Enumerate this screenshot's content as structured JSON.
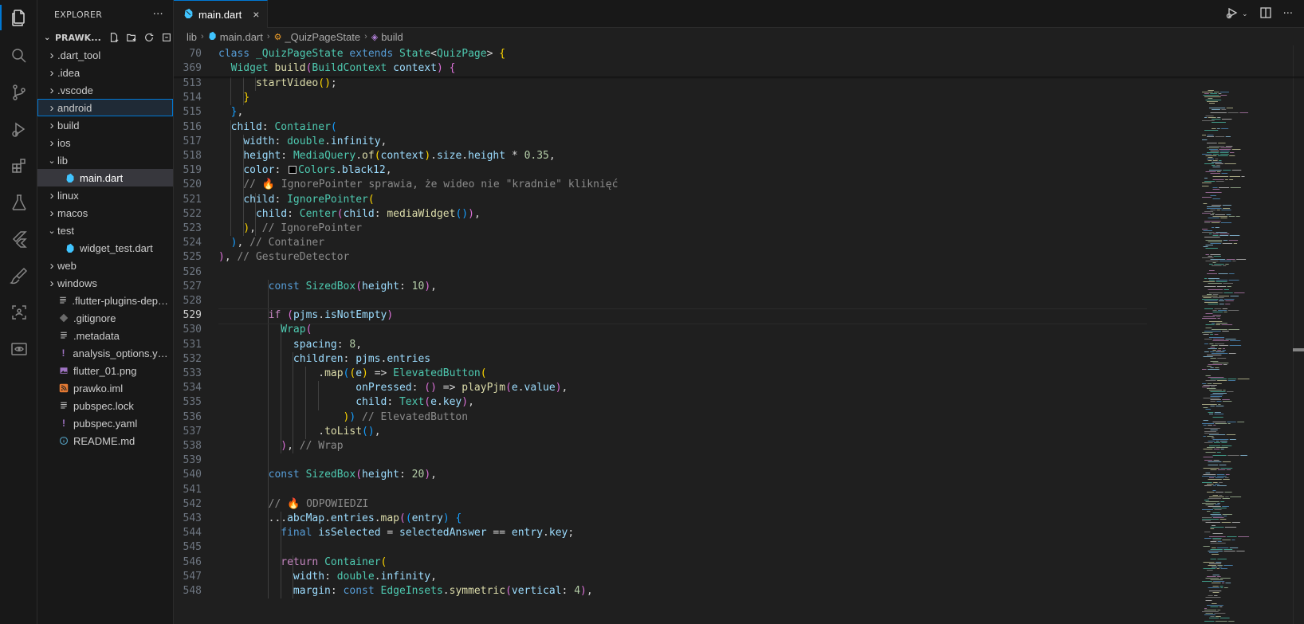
{
  "activity_bar": [
    "files-icon",
    "search-icon",
    "source-control-icon",
    "run-debug-icon",
    "extensions-icon",
    "testing-icon",
    "flutter-icon",
    "paint-icon",
    "remote-explorer-icon",
    "preview-icon"
  ],
  "sidebar": {
    "title": "EXPLORER",
    "more": "···",
    "folder": "PRAWK...",
    "items": [
      {
        "label": ".dart_tool",
        "type": "folder",
        "depth": 0
      },
      {
        "label": ".idea",
        "type": "folder",
        "depth": 0
      },
      {
        "label": ".vscode",
        "type": "folder",
        "depth": 0
      },
      {
        "label": "android",
        "type": "folder",
        "depth": 0,
        "focused": true
      },
      {
        "label": "build",
        "type": "folder",
        "depth": 0
      },
      {
        "label": "ios",
        "type": "folder",
        "depth": 0
      },
      {
        "label": "lib",
        "type": "folder-open",
        "depth": 0
      },
      {
        "label": "main.dart",
        "type": "dart",
        "depth": 1,
        "selected": true
      },
      {
        "label": "linux",
        "type": "folder",
        "depth": 0
      },
      {
        "label": "macos",
        "type": "folder",
        "depth": 0
      },
      {
        "label": "test",
        "type": "folder-open",
        "depth": 0
      },
      {
        "label": "widget_test.dart",
        "type": "dart",
        "depth": 1
      },
      {
        "label": "web",
        "type": "folder",
        "depth": 0
      },
      {
        "label": "windows",
        "type": "folder",
        "depth": 0
      },
      {
        "label": ".flutter-plugins-depen...",
        "type": "file",
        "depth": 0
      },
      {
        "label": ".gitignore",
        "type": "git",
        "depth": 0
      },
      {
        "label": ".metadata",
        "type": "file",
        "depth": 0
      },
      {
        "label": "analysis_options.yaml",
        "type": "yaml",
        "depth": 0
      },
      {
        "label": "flutter_01.png",
        "type": "png",
        "depth": 0
      },
      {
        "label": "prawko.iml",
        "type": "rss",
        "depth": 0
      },
      {
        "label": "pubspec.lock",
        "type": "file",
        "depth": 0
      },
      {
        "label": "pubspec.yaml",
        "type": "yaml",
        "depth": 0
      },
      {
        "label": "README.md",
        "type": "info",
        "depth": 0
      }
    ]
  },
  "tabs": [
    {
      "label": "main.dart",
      "close": "×"
    }
  ],
  "breadcrumb": [
    "lib",
    "main.dart",
    "_QuizPageState",
    "build"
  ],
  "sticky_lines": [
    {
      "num": "70",
      "html": "<span class=\"k\">class</span> <span class=\"t\">_QuizPageState</span> <span class=\"k\">extends</span> <span class=\"t\">State</span><span class=\"p\">&lt;</span><span class=\"t\">QuizPage</span><span class=\"p\">&gt;</span> <span class=\"b1\">{</span>"
    },
    {
      "num": "369",
      "html": "  <span class=\"t\">Widget</span> <span class=\"f\">build</span><span class=\"b2\">(</span><span class=\"t\">BuildContext</span> <span class=\"v\">context</span><span class=\"b2\">)</span> <span class=\"b2\">{</span>"
    }
  ],
  "code_lines": [
    {
      "num": "513",
      "html": "      <span class=\"f\">startVideo</span><span class=\"b1\">()</span><span class=\"p\">;</span>"
    },
    {
      "num": "514",
      "html": "    <span class=\"b1\">}</span>"
    },
    {
      "num": "515",
      "html": "  <span class=\"b3\">}</span><span class=\"p\">,</span>"
    },
    {
      "num": "516",
      "html": "  <span class=\"v\">child</span><span class=\"p\">:</span> <span class=\"t\">Container</span><span class=\"b3\">(</span>"
    },
    {
      "num": "517",
      "html": "    <span class=\"v\">width</span><span class=\"p\">:</span> <span class=\"t\">double</span><span class=\"p\">.</span><span class=\"v\">infinity</span><span class=\"p\">,</span>"
    },
    {
      "num": "518",
      "html": "    <span class=\"v\">height</span><span class=\"p\">:</span> <span class=\"t\">MediaQuery</span><span class=\"p\">.</span><span class=\"f\">of</span><span class=\"b1\">(</span><span class=\"v\">context</span><span class=\"b1\">)</span><span class=\"p\">.</span><span class=\"v\">size</span><span class=\"p\">.</span><span class=\"v\">height</span> <span class=\"p\">*</span> <span class=\"n\">0.35</span><span class=\"p\">,</span>"
    },
    {
      "num": "519",
      "html": "    <span class=\"v\">color</span><span class=\"p\">:</span> <span class=\"swatch\"></span><span class=\"t\">Colors</span><span class=\"p\">.</span><span class=\"v\">black12</span><span class=\"p\">,</span>"
    },
    {
      "num": "520",
      "html": "    <span class=\"c\">// 🔥 IgnorePointer sprawia, że wideo nie \"kradnie\" kliknięć</span>"
    },
    {
      "num": "521",
      "html": "    <span class=\"v\">child</span><span class=\"p\">:</span> <span class=\"t\">IgnorePointer</span><span class=\"b1\">(</span>"
    },
    {
      "num": "522",
      "html": "      <span class=\"v\">child</span><span class=\"p\">:</span> <span class=\"t\">Center</span><span class=\"b2\">(</span><span class=\"v\">child</span><span class=\"p\">:</span> <span class=\"f\">mediaWidget</span><span class=\"b3\">()</span><span class=\"b2\">)</span><span class=\"p\">,</span>"
    },
    {
      "num": "523",
      "html": "    <span class=\"b1\">)</span><span class=\"p\">,</span> <span class=\"c\">// IgnorePointer</span>"
    },
    {
      "num": "524",
      "html": "  <span class=\"b3\">)</span><span class=\"p\">,</span> <span class=\"c\">// Container</span>"
    },
    {
      "num": "525",
      "html": "<span class=\"b2\">)</span><span class=\"p\">,</span> <span class=\"c\">// GestureDetector</span>"
    },
    {
      "num": "526",
      "html": ""
    },
    {
      "num": "527",
      "html": "        <span class=\"k\">const</span> <span class=\"t\">SizedBox</span><span class=\"b2\">(</span><span class=\"v\">height</span><span class=\"p\">:</span> <span class=\"n\">10</span><span class=\"b2\">)</span><span class=\"p\">,</span>"
    },
    {
      "num": "528",
      "html": ""
    },
    {
      "num": "529",
      "html": "        <span class=\"kc\">if</span> <span class=\"b2\">(</span><span class=\"v\">pjms</span><span class=\"p\">.</span><span class=\"v\">isNotEmpty</span><span class=\"b2\">)</span>",
      "current": true
    },
    {
      "num": "530",
      "html": "          <span class=\"t\">Wrap</span><span class=\"b2\">(</span>"
    },
    {
      "num": "531",
      "html": "            <span class=\"v\">spacing</span><span class=\"p\">:</span> <span class=\"n\">8</span><span class=\"p\">,</span>"
    },
    {
      "num": "532",
      "html": "            <span class=\"v\">children</span><span class=\"p\">:</span> <span class=\"v\">pjms</span><span class=\"p\">.</span><span class=\"v\">entries</span>"
    },
    {
      "num": "533",
      "html": "                <span class=\"p\">.</span><span class=\"f\">map</span><span class=\"b3\">(</span><span class=\"b1\">(</span><span class=\"v\">e</span><span class=\"b1\">)</span> <span class=\"p\">=&gt;</span> <span class=\"t\">ElevatedButton</span><span class=\"b1\">(</span>"
    },
    {
      "num": "534",
      "html": "                      <span class=\"v\">onPressed</span><span class=\"p\">:</span> <span class=\"b2\">()</span> <span class=\"p\">=&gt;</span> <span class=\"f\">playPjm</span><span class=\"b2\">(</span><span class=\"v\">e</span><span class=\"p\">.</span><span class=\"v\">value</span><span class=\"b2\">)</span><span class=\"p\">,</span>"
    },
    {
      "num": "535",
      "html": "                      <span class=\"v\">child</span><span class=\"p\">:</span> <span class=\"t\">Text</span><span class=\"b2\">(</span><span class=\"v\">e</span><span class=\"p\">.</span><span class=\"v\">key</span><span class=\"b2\">)</span><span class=\"p\">,</span>"
    },
    {
      "num": "536",
      "html": "                    <span class=\"b1\">)</span><span class=\"b3\">)</span> <span class=\"c\">// ElevatedButton</span>"
    },
    {
      "num": "537",
      "html": "                <span class=\"p\">.</span><span class=\"f\">toList</span><span class=\"b3\">()</span><span class=\"p\">,</span>"
    },
    {
      "num": "538",
      "html": "          <span class=\"b2\">)</span><span class=\"p\">,</span> <span class=\"c\">// Wrap</span>"
    },
    {
      "num": "539",
      "html": ""
    },
    {
      "num": "540",
      "html": "        <span class=\"k\">const</span> <span class=\"t\">SizedBox</span><span class=\"b2\">(</span><span class=\"v\">height</span><span class=\"p\">:</span> <span class=\"n\">20</span><span class=\"b2\">)</span><span class=\"p\">,</span>"
    },
    {
      "num": "541",
      "html": ""
    },
    {
      "num": "542",
      "html": "        <span class=\"c\">// 🔥 ODPOWIEDZI</span>"
    },
    {
      "num": "543",
      "html": "        <span class=\"p\">...</span><span class=\"v\">abcMap</span><span class=\"p\">.</span><span class=\"v\">entries</span><span class=\"p\">.</span><span class=\"f\">map</span><span class=\"b2\">(</span><span class=\"b3\">(</span><span class=\"v\">entry</span><span class=\"b3\">)</span> <span class=\"b3\">{</span>"
    },
    {
      "num": "544",
      "html": "          <span class=\"k\">final</span> <span class=\"v\">isSelected</span> <span class=\"p\">=</span> <span class=\"v\">selectedAnswer</span> <span class=\"p\">==</span> <span class=\"v\">entry</span><span class=\"p\">.</span><span class=\"v\">key</span><span class=\"p\">;</span>"
    },
    {
      "num": "545",
      "html": ""
    },
    {
      "num": "546",
      "html": "          <span class=\"kc\">return</span> <span class=\"t\">Container</span><span class=\"b1\">(</span>"
    },
    {
      "num": "547",
      "html": "            <span class=\"v\">width</span><span class=\"p\">:</span> <span class=\"t\">double</span><span class=\"p\">.</span><span class=\"v\">infinity</span><span class=\"p\">,</span>"
    },
    {
      "num": "548",
      "html": "            <span class=\"v\">margin</span><span class=\"p\">:</span> <span class=\"k\">const</span> <span class=\"t\">EdgeInsets</span><span class=\"p\">.</span><span class=\"f\">symmetric</span><span class=\"b2\">(</span><span class=\"v\">vertical</span><span class=\"p\">:</span> <span class=\"n\">4</span><span class=\"b2\">)</span><span class=\"p\">,</span>"
    }
  ],
  "colors": {
    "accent": "#0078d4",
    "folder_icon": "#c5c5c5",
    "dart_icon": "#40c4ff",
    "yaml_icon": "#a074c4",
    "png_icon": "#a074c4",
    "rss_icon": "#e37933"
  }
}
